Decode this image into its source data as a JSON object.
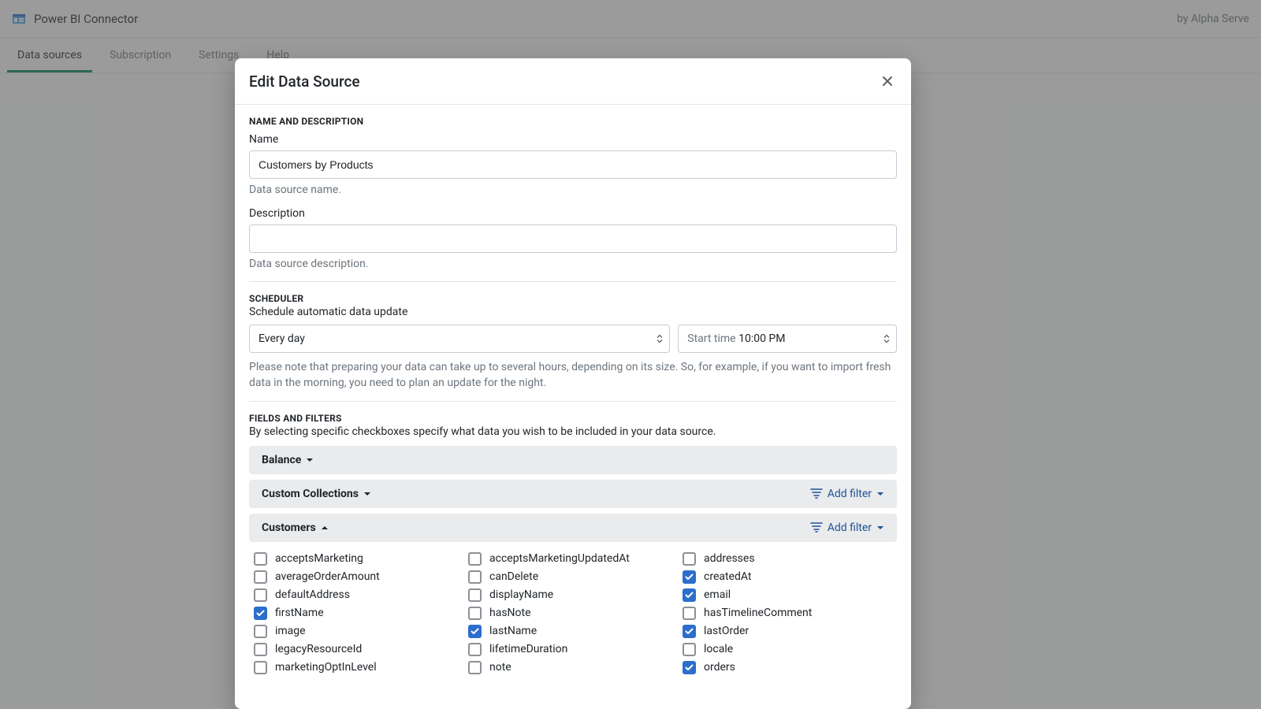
{
  "header": {
    "title": "Power BI Connector",
    "by": "by Alpha Serve"
  },
  "tabs": [
    "Data sources",
    "Subscription",
    "Settings",
    "Help"
  ],
  "modal": {
    "title": "Edit Data Source",
    "section_name_desc": "NAME AND DESCRIPTION",
    "name_label": "Name",
    "name_value": "Customers by Products",
    "name_helper": "Data source name.",
    "desc_label": "Description",
    "desc_value": "",
    "desc_helper": "Data source description.",
    "section_scheduler": "SCHEDULER",
    "scheduler_sub": "Schedule automatic data update",
    "freq": "Every day",
    "start_prefix": "Start time",
    "start_value": "10:00 PM",
    "scheduler_note": "Please note that preparing your data can take up to several hours, depending on its size. So, for example, if you want to import fresh data in the morning, you need to plan an update for the night.",
    "section_fields": "FIELDS AND FILTERS",
    "fields_sub": "By selecting specific checkboxes specify what data you wish to be included in your data source.",
    "add_filter": "Add filter",
    "accordions": {
      "balance": "Balance",
      "custom_collections": "Custom Collections",
      "customers": "Customers"
    },
    "customer_fields": [
      {
        "label": "acceptsMarketing",
        "checked": false
      },
      {
        "label": "acceptsMarketingUpdatedAt",
        "checked": false
      },
      {
        "label": "addresses",
        "checked": false
      },
      {
        "label": "averageOrderAmount",
        "checked": false
      },
      {
        "label": "canDelete",
        "checked": false
      },
      {
        "label": "createdAt",
        "checked": true
      },
      {
        "label": "defaultAddress",
        "checked": false
      },
      {
        "label": "displayName",
        "checked": false
      },
      {
        "label": "email",
        "checked": true
      },
      {
        "label": "firstName",
        "checked": true
      },
      {
        "label": "hasNote",
        "checked": false
      },
      {
        "label": "hasTimelineComment",
        "checked": false
      },
      {
        "label": "image",
        "checked": false
      },
      {
        "label": "lastName",
        "checked": true
      },
      {
        "label": "lastOrder",
        "checked": true
      },
      {
        "label": "legacyResourceId",
        "checked": false
      },
      {
        "label": "lifetimeDuration",
        "checked": false
      },
      {
        "label": "locale",
        "checked": false
      },
      {
        "label": "marketingOptInLevel",
        "checked": false
      },
      {
        "label": "note",
        "checked": false
      },
      {
        "label": "orders",
        "checked": true
      }
    ]
  }
}
